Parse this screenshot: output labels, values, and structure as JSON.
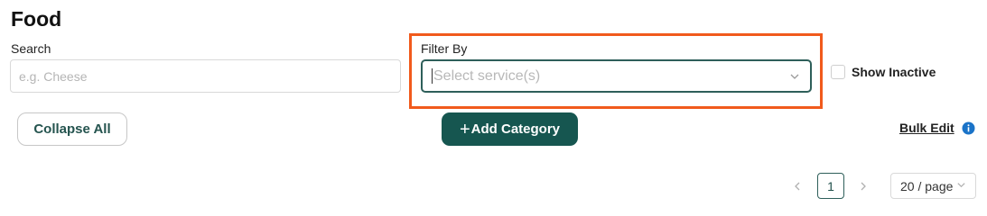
{
  "page": {
    "title": "Food"
  },
  "search": {
    "label": "Search",
    "placeholder": "e.g. Cheese",
    "value": ""
  },
  "filter": {
    "label": "Filter By",
    "placeholder": "Select service(s)"
  },
  "show_inactive": {
    "label": "Show Inactive",
    "checked": false
  },
  "actions": {
    "collapse_all": "Collapse All",
    "add_category": "Add Category",
    "bulk_edit": "Bulk Edit"
  },
  "pagination": {
    "current_page": "1",
    "page_size": "20 / page"
  },
  "icons": {
    "filter_dropdown": "chevron-down-icon",
    "add": "plus-icon",
    "bulk_edit_info": "info-icon",
    "prev": "chevron-left-icon",
    "next": "chevron-right-icon",
    "page_size": "chevron-down-icon"
  },
  "colors": {
    "primary": "#165650",
    "focus_border": "#2e5f5a",
    "highlight": "#f15a1c",
    "info": "#1a73c8"
  }
}
